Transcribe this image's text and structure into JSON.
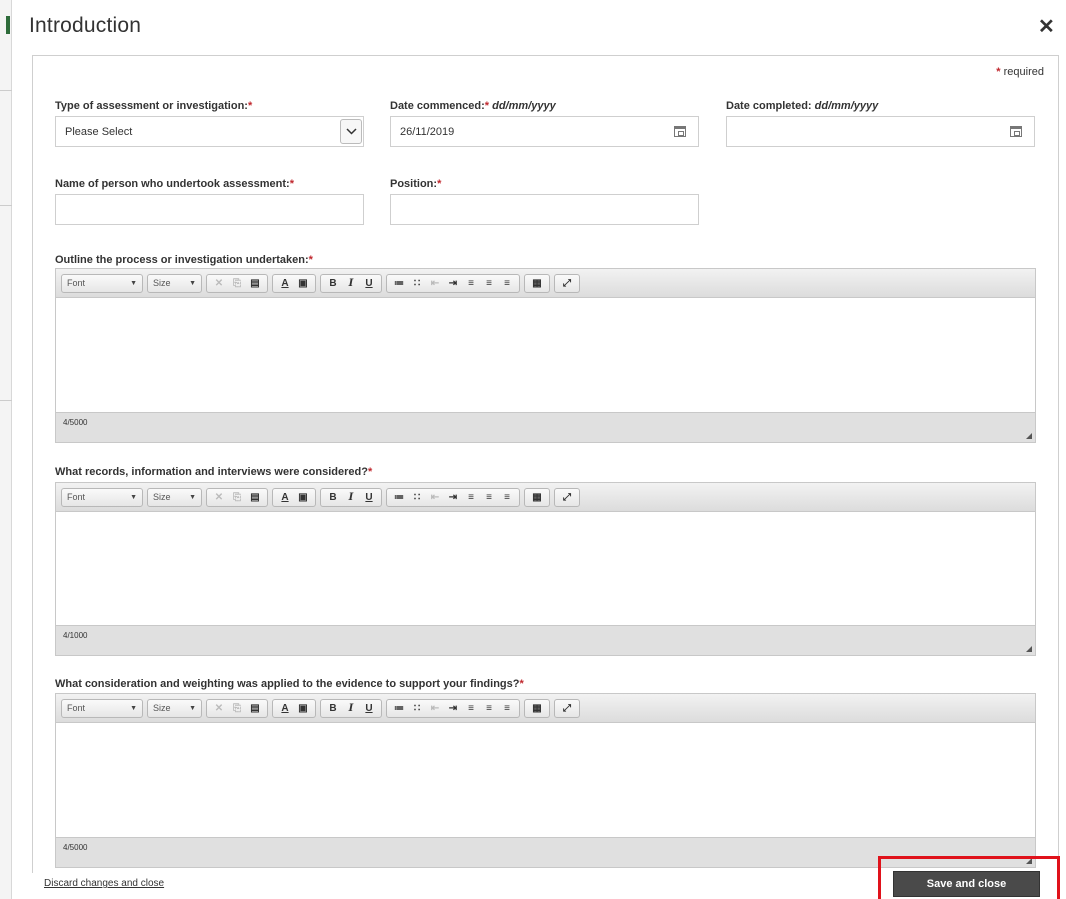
{
  "dialog": {
    "title": "Introduction",
    "close_glyph": "✕",
    "required_marker": "*",
    "required_text": "required"
  },
  "fields": {
    "assessment_type": {
      "label": "Type of assessment or investigation:",
      "required": "*",
      "value": "Please Select"
    },
    "date_commenced": {
      "label": "Date commenced:",
      "required": "*",
      "format": "dd/mm/yyyy",
      "value": "26/11/2019"
    },
    "date_completed": {
      "label": "Date completed:",
      "format": "dd/mm/yyyy",
      "value": ""
    },
    "assessor_name": {
      "label": "Name of person who undertook assessment:",
      "required": "*",
      "value": ""
    },
    "position": {
      "label": "Position:",
      "required": "*",
      "value": ""
    }
  },
  "editors": [
    {
      "label": "Outline the process or investigation undertaken:",
      "required": "*",
      "counter": "4/5000"
    },
    {
      "label": "What records, information and interviews were considered?",
      "required": "*",
      "counter": "4/1000"
    },
    {
      "label": "What consideration and weighting was applied to the evidence to support your findings?",
      "required": "*",
      "counter": "4/5000"
    }
  ],
  "toolbar": {
    "font_label": "Font",
    "size_label": "Size",
    "cut_glyph": "✕",
    "copy_glyph": "⎘",
    "paste_glyph": "▤",
    "text_color_glyph": "A",
    "bg_color_glyph": "▣",
    "bold_glyph": "B",
    "italic_glyph": "I",
    "underline_glyph": "U",
    "numbered_list_glyph": "≔",
    "bullet_list_glyph": "∷",
    "outdent_glyph": "⇤",
    "indent_glyph": "⇥",
    "align_left_glyph": "≡",
    "align_center_glyph": "≡",
    "align_right_glyph": "≡",
    "table_glyph": "▦",
    "maximize_glyph": "⤢"
  },
  "footer": {
    "discard_label": "Discard changes and close",
    "save_label": "Save and close"
  },
  "colors": {
    "required": "#c0272d",
    "save_button": "#4a4a4a",
    "highlight": "#e0121b"
  }
}
